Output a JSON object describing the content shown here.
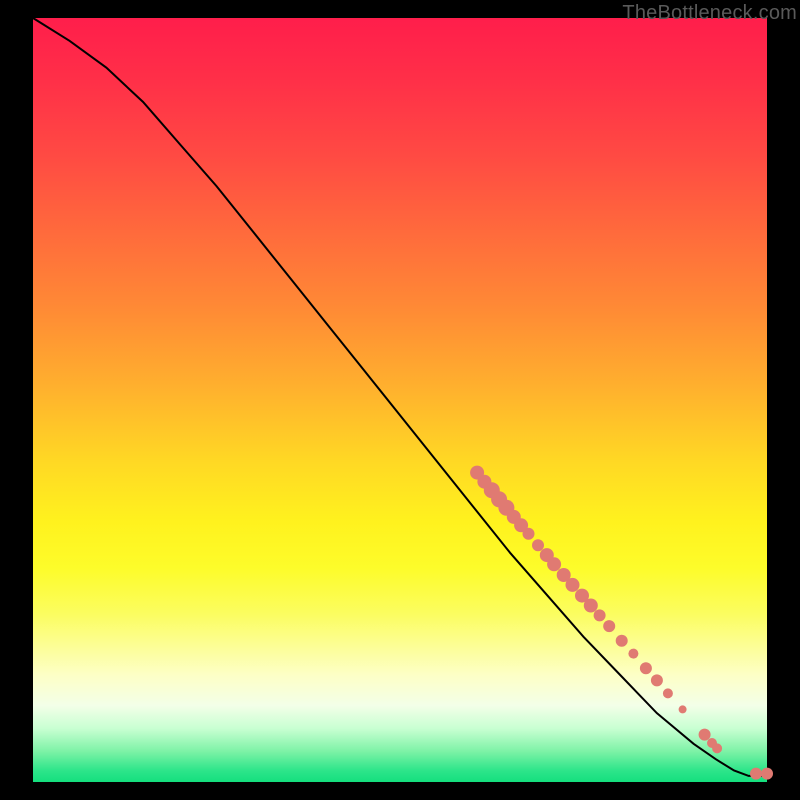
{
  "watermark": "TheBottleneck.com",
  "colors": {
    "marker": "#e07a72",
    "curve": "#000000",
    "gradient_top": "#ff1e4b",
    "gradient_mid": "#ffe021",
    "gradient_bottom": "#14df7e"
  },
  "chart_data": {
    "type": "line",
    "title": "",
    "xlabel": "",
    "ylabel": "",
    "xlim": [
      0,
      100
    ],
    "ylim": [
      0,
      100
    ],
    "grid": false,
    "legend": false,
    "curve": [
      {
        "x": 0,
        "y": 100
      },
      {
        "x": 5,
        "y": 97
      },
      {
        "x": 10,
        "y": 93.5
      },
      {
        "x": 15,
        "y": 89
      },
      {
        "x": 20,
        "y": 83.5
      },
      {
        "x": 25,
        "y": 78
      },
      {
        "x": 30,
        "y": 72
      },
      {
        "x": 35,
        "y": 66
      },
      {
        "x": 40,
        "y": 60
      },
      {
        "x": 45,
        "y": 54
      },
      {
        "x": 50,
        "y": 48
      },
      {
        "x": 55,
        "y": 42
      },
      {
        "x": 60,
        "y": 36
      },
      {
        "x": 65,
        "y": 30
      },
      {
        "x": 70,
        "y": 24.5
      },
      {
        "x": 75,
        "y": 19
      },
      {
        "x": 80,
        "y": 14
      },
      {
        "x": 85,
        "y": 9
      },
      {
        "x": 90,
        "y": 5
      },
      {
        "x": 93,
        "y": 3
      },
      {
        "x": 95.5,
        "y": 1.5
      },
      {
        "x": 97.5,
        "y": 0.8
      },
      {
        "x": 100,
        "y": 0.8
      }
    ],
    "markers": [
      {
        "x": 60.5,
        "y": 40.5,
        "r": 7
      },
      {
        "x": 61.5,
        "y": 39.3,
        "r": 7
      },
      {
        "x": 62.5,
        "y": 38.2,
        "r": 8
      },
      {
        "x": 63.5,
        "y": 37.0,
        "r": 8
      },
      {
        "x": 64.5,
        "y": 35.9,
        "r": 8
      },
      {
        "x": 65.5,
        "y": 34.7,
        "r": 7
      },
      {
        "x": 66.5,
        "y": 33.6,
        "r": 7
      },
      {
        "x": 67.5,
        "y": 32.5,
        "r": 6
      },
      {
        "x": 68.8,
        "y": 31.0,
        "r": 6
      },
      {
        "x": 70.0,
        "y": 29.7,
        "r": 7
      },
      {
        "x": 71.0,
        "y": 28.5,
        "r": 7
      },
      {
        "x": 72.3,
        "y": 27.1,
        "r": 7
      },
      {
        "x": 73.5,
        "y": 25.8,
        "r": 7
      },
      {
        "x": 74.8,
        "y": 24.4,
        "r": 7
      },
      {
        "x": 76.0,
        "y": 23.1,
        "r": 7
      },
      {
        "x": 77.2,
        "y": 21.8,
        "r": 6
      },
      {
        "x": 78.5,
        "y": 20.4,
        "r": 6
      },
      {
        "x": 80.2,
        "y": 18.5,
        "r": 6
      },
      {
        "x": 81.8,
        "y": 16.8,
        "r": 5
      },
      {
        "x": 83.5,
        "y": 14.9,
        "r": 6
      },
      {
        "x": 85.0,
        "y": 13.3,
        "r": 6
      },
      {
        "x": 86.5,
        "y": 11.6,
        "r": 5
      },
      {
        "x": 88.5,
        "y": 9.5,
        "r": 4
      },
      {
        "x": 91.5,
        "y": 6.2,
        "r": 6
      },
      {
        "x": 92.5,
        "y": 5.1,
        "r": 5
      },
      {
        "x": 93.2,
        "y": 4.4,
        "r": 5
      },
      {
        "x": 98.5,
        "y": 1.1,
        "r": 6
      },
      {
        "x": 100,
        "y": 1.1,
        "r": 6
      }
    ]
  }
}
